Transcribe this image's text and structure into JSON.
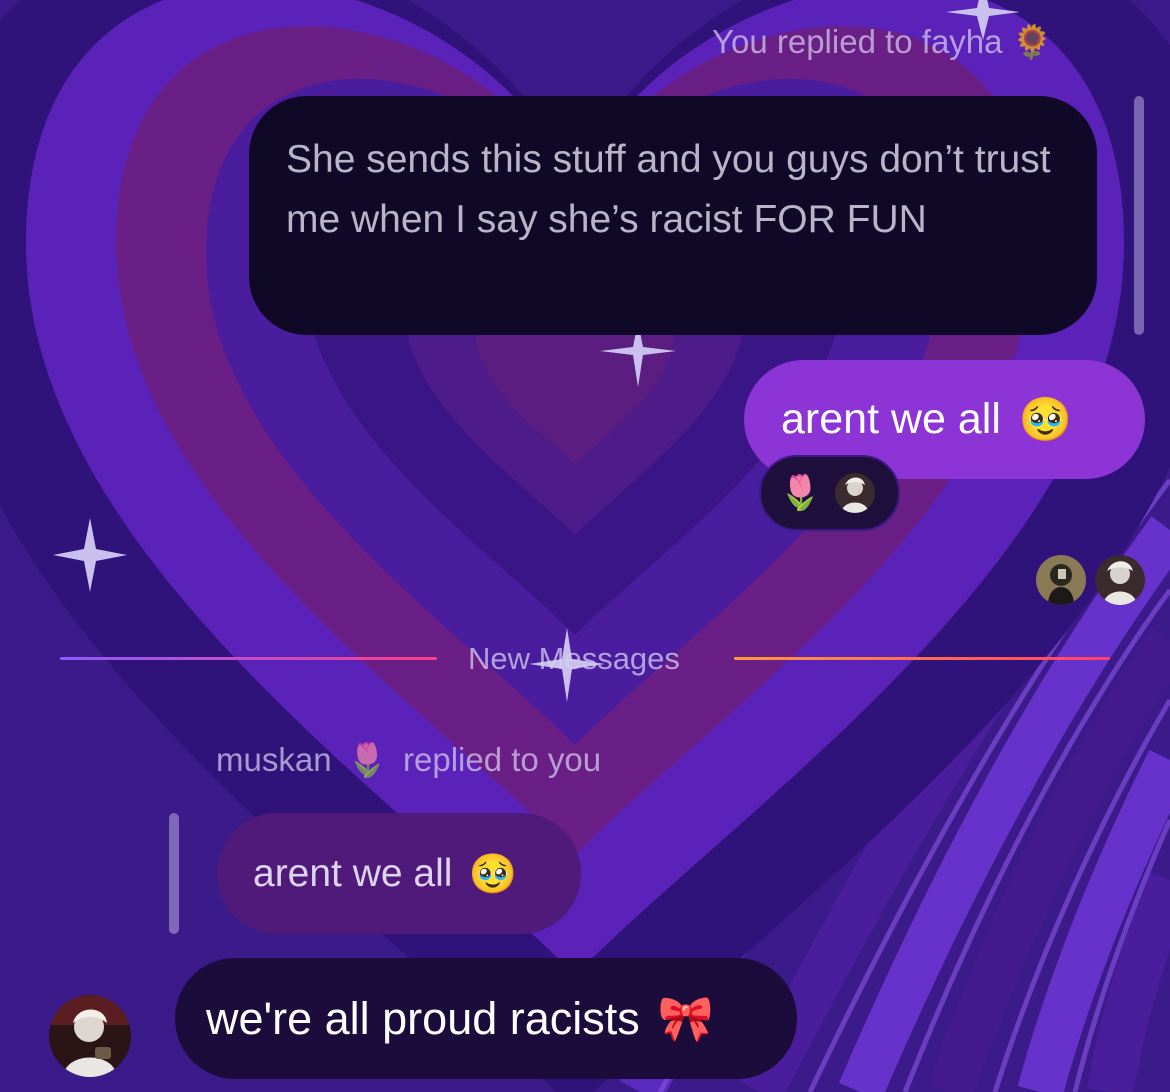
{
  "thread": {
    "outgoing_reply": {
      "context_label": "You replied to fayha",
      "context_emoji": "🌻",
      "quoted_text": "She sends this stuff and you guys don’t trust me when I say she’s racist FOR FUN"
    },
    "sent_message": {
      "text": "arent we all",
      "emoji": "🥹",
      "reaction_emoji": "🌷"
    },
    "divider": {
      "label": "New Messages"
    },
    "incoming_reply": {
      "sender": "muskan",
      "sender_emoji": "🌷",
      "context_suffix": "replied to you",
      "quoted_text": "arent we all",
      "quoted_emoji": "🥹"
    },
    "received_message": {
      "text": "we're all proud racists",
      "emoji": "🎀"
    }
  },
  "colors": {
    "background": "#3a1a86",
    "sent_bubble": "#8d34d6",
    "received_bubble": "#1c0c3c",
    "quoted_bubble": "#0f0826",
    "divider_gradient_left": [
      "#8a5cff",
      "#ff3f8a"
    ],
    "divider_gradient_right": [
      "#ff9a3c",
      "#ff3f6a"
    ]
  },
  "icons": [
    "sparkle-icon",
    "heart-pattern",
    "avatar"
  ]
}
